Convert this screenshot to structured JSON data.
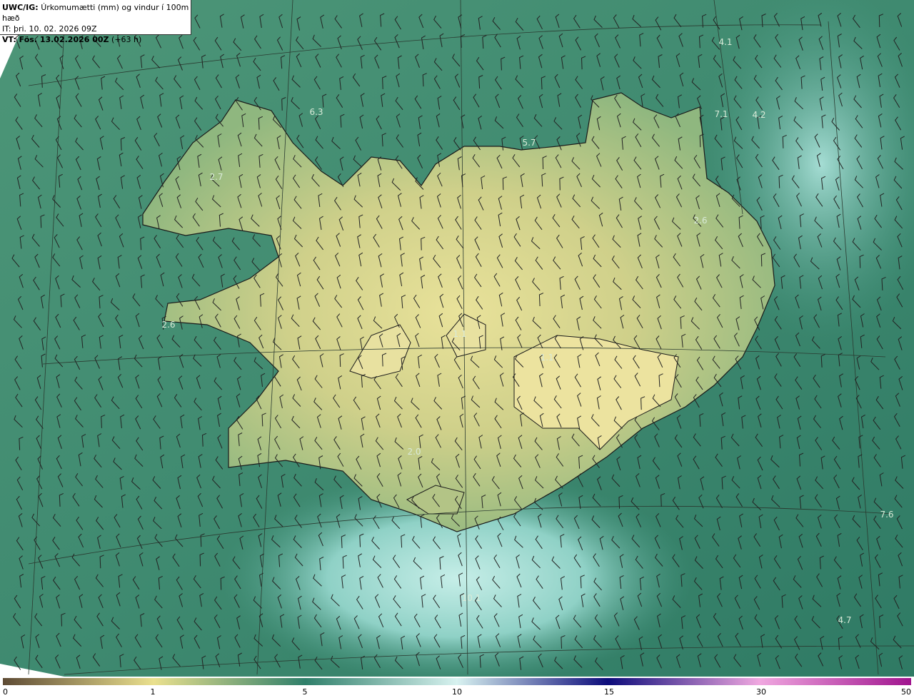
{
  "header": {
    "model": "UWC/IG:",
    "title": "Úrkomumætti (mm) og vindur í 100m hæð",
    "it_line": "IT: þri. 10. 02. 2026 09Z",
    "vt_prefix": "VT: Fös. 13.02.2026 00Z",
    "vt_suffix": "(+63 h)"
  },
  "map_labels": [
    "4.1",
    "6.3",
    "7.1",
    "4.2",
    "5.7",
    "2.7",
    "2.6",
    "2.6",
    "1.1",
    "1.1",
    "2.0",
    "7.6",
    "10.1",
    "4.7"
  ],
  "colorbar": {
    "ticks": [
      "0",
      "1",
      "5",
      "10",
      "15",
      "30",
      "50"
    ],
    "colors": {
      "c0": "#5e4b35",
      "c1": "#eae08e",
      "c5": "#2f7f6a",
      "c10": "#d8f2f0",
      "c15": "#0c0b7a",
      "c30": "#f0a8e0",
      "c50": "#a0148e"
    }
  },
  "colors": {
    "sea_mid": "#3f8c74",
    "sea_light": "#9fdcd2",
    "land_low": "#dbd58c",
    "coast": "#1a1a1a"
  }
}
